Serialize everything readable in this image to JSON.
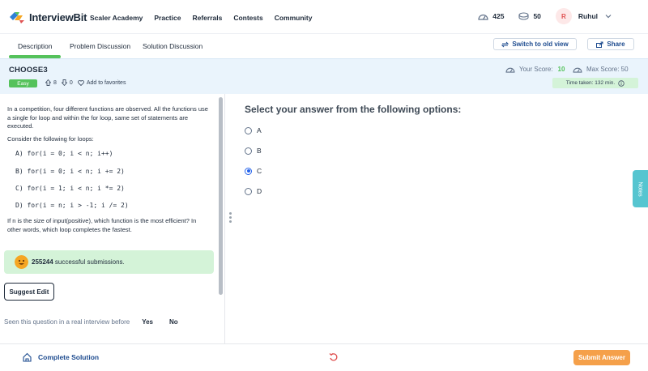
{
  "brand": {
    "logo_text": "InterviewBit",
    "logo_colors": [
      "#2f7fd4",
      "#55c25b",
      "#f5a623",
      "#e05252"
    ]
  },
  "nav": {
    "links": [
      "Scaler Academy",
      "Practice",
      "Referrals",
      "Contests",
      "Community"
    ],
    "stats": {
      "streak": "425",
      "coins": "50"
    },
    "user": {
      "initial": "R",
      "name": "Ruhul"
    }
  },
  "tabs": {
    "items": [
      "Description",
      "Problem Discussion",
      "Solution Discussion"
    ],
    "active": "Description",
    "switch_label": "Switch to old view",
    "share_label": "Share"
  },
  "problem": {
    "title": "CHOOSE3",
    "difficulty": "Easy",
    "upvotes": "8",
    "downvotes": "0",
    "favorites_label": "Add to favorites",
    "your_score_label": "Your Score:",
    "your_score": "10",
    "max_score_label": "Max Score: 50",
    "time_taken": "Time taken: 132 min."
  },
  "description": {
    "intro": "In a competition, four different functions are observed. All the functions use a single for loop and within the for loop, same set of statements are executed.",
    "consider": "Consider the following for loops:",
    "loops": [
      "A) for(i = 0; i < n; i++)",
      "B) for(i = 0; i < n; i += 2)",
      "C) for(i = 1; i < n; i *= 2)",
      "D) for(i = n; i > -1; i /= 2)"
    ],
    "question": "If n is the size of input(positive), which function is the most efficient? In other words, which loop completes the fastest.",
    "success_count": "255244",
    "success_suffix": " successful submissions.",
    "suggest_edit": "Suggest Edit",
    "seen_label": "Seen this question in a real interview before",
    "yes": "Yes",
    "no": "No"
  },
  "answers": {
    "title": "Select your answer from the following options:",
    "options": [
      "A",
      "B",
      "C",
      "D"
    ],
    "selected": "C"
  },
  "notes_label": "Notes",
  "bottom": {
    "complete_solution": "Complete Solution",
    "submit": "Submit Answer"
  }
}
